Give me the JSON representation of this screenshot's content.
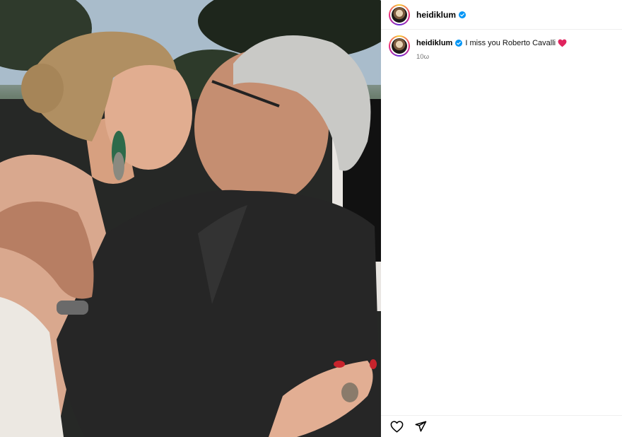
{
  "post": {
    "username": "heidiklum",
    "verified": true,
    "caption": "I miss you Roberto Cavalli",
    "caption_emoji": "red-heart",
    "timestamp": "10ω"
  },
  "colors": {
    "verified_badge": "#0095f6",
    "timestamp": "#737373",
    "heart": "#e0245e",
    "divider": "#efefef"
  },
  "icons": {
    "like": "heart-outline-icon",
    "share": "paper-plane-icon"
  }
}
